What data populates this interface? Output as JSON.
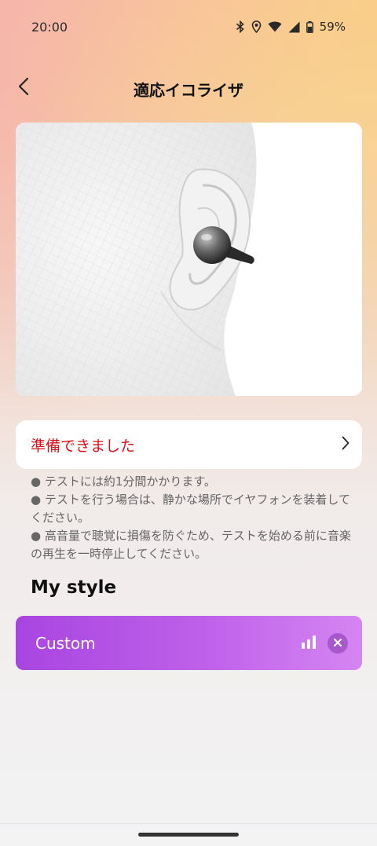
{
  "status_bar": {
    "time": "20:00",
    "battery": "59%",
    "icons": [
      "bluetooth-icon",
      "location-icon",
      "wifi-icon",
      "signal-icon",
      "battery-icon"
    ]
  },
  "header": {
    "title": "適応イコライザ",
    "back_icon": "chevron-left-icon"
  },
  "hero": {
    "image": "ear-with-earbud-illustration"
  },
  "ready_row": {
    "label": "準備できました",
    "icon": "chevron-right-icon",
    "color": "#e0101a"
  },
  "notes": [
    "● テストには約1分間かかります。",
    "● テストを行う場合は、静かな場所でイヤフォンを装着してください。",
    "● 高音量で聴覚に損傷を防ぐため、テストを始める前に音楽の再生を一時停止してください。"
  ],
  "my_style": {
    "title": "My style",
    "preset": {
      "label": "Custom",
      "icons": [
        "equalizer-bars-icon",
        "close-icon"
      ],
      "accent": "#b050e4"
    }
  }
}
